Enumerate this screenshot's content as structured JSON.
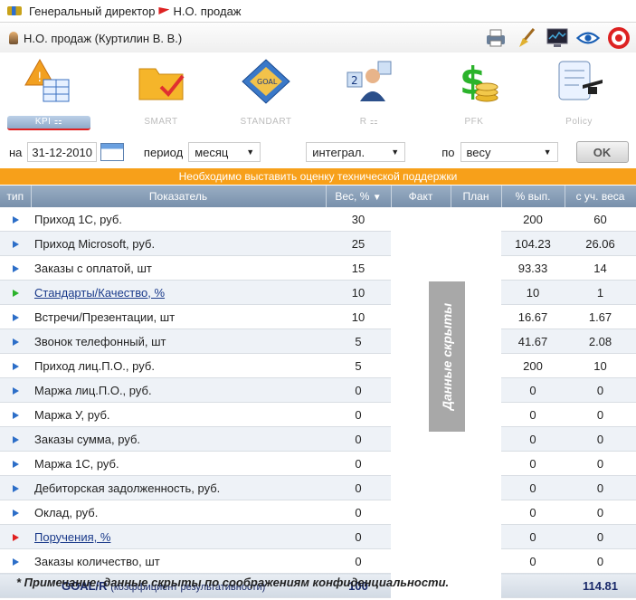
{
  "titlebar": {
    "role": "Генеральный директор",
    "dept": "Н.О. продаж"
  },
  "user": {
    "name": "Н.О. продаж  (Куртилин В. В.)"
  },
  "tools": [
    "printer-icon",
    "broom-icon",
    "monitor-icon",
    "eye-icon",
    "target-icon"
  ],
  "nav": [
    {
      "label": "KPI",
      "icon": "warning-table-icon",
      "active": true
    },
    {
      "label": "SMART",
      "icon": "folder-check-icon",
      "active": false
    },
    {
      "label": "STANDART",
      "icon": "goal-compass-icon",
      "active": false
    },
    {
      "label": "R",
      "icon": "person-numbers-icon",
      "active": false
    },
    {
      "label": "PFK",
      "icon": "dollar-coins-icon",
      "active": false
    },
    {
      "label": "Policy",
      "icon": "scroll-graduation-icon",
      "active": false
    }
  ],
  "filters": {
    "date_label": "на",
    "date_value": "31-12-2010",
    "period_label": "период",
    "period_value": "месяц",
    "mode_value": "интеграл.",
    "by_label": "по",
    "by_value": "весу",
    "ok_label": "OK"
  },
  "notice": "Необходимо выставить оценку технической поддержки",
  "table": {
    "headers": [
      "тип",
      "Показатель",
      "Вес, %",
      "Факт",
      "План",
      "% вып.",
      "с уч. веса"
    ],
    "rows": [
      {
        "type": "blue",
        "name": "Приход 1С, руб.",
        "link": false,
        "weight": "30",
        "pct": "200",
        "weighted": "60"
      },
      {
        "type": "blue",
        "name": "Приход Microsoft, руб.",
        "link": false,
        "weight": "25",
        "pct": "104.23",
        "weighted": "26.06"
      },
      {
        "type": "blue",
        "name": "Заказы с оплатой, шт",
        "link": false,
        "weight": "15",
        "pct": "93.33",
        "weighted": "14"
      },
      {
        "type": "green",
        "name": "Стандарты/Качество, %",
        "link": true,
        "weight": "10",
        "pct": "10",
        "weighted": "1"
      },
      {
        "type": "blue",
        "name": "Встречи/Презентации, шт",
        "link": false,
        "weight": "10",
        "pct": "16.67",
        "weighted": "1.67"
      },
      {
        "type": "blue",
        "name": "Звонок телефонный, шт",
        "link": false,
        "weight": "5",
        "pct": "41.67",
        "weighted": "2.08"
      },
      {
        "type": "blue",
        "name": "Приход лиц.П.О., руб.",
        "link": false,
        "weight": "5",
        "pct": "200",
        "weighted": "10"
      },
      {
        "type": "blue",
        "name": "Маржа лиц.П.О., руб.",
        "link": false,
        "weight": "0",
        "pct": "0",
        "weighted": "0"
      },
      {
        "type": "blue",
        "name": "Маржа У, руб.",
        "link": false,
        "weight": "0",
        "pct": "0",
        "weighted": "0"
      },
      {
        "type": "blue",
        "name": "Заказы сумма, руб.",
        "link": false,
        "weight": "0",
        "pct": "0",
        "weighted": "0"
      },
      {
        "type": "blue",
        "name": "Маржа 1С, руб.",
        "link": false,
        "weight": "0",
        "pct": "0",
        "weighted": "0"
      },
      {
        "type": "blue",
        "name": "Дебиторская задолженность, руб.",
        "link": false,
        "weight": "0",
        "pct": "0",
        "weighted": "0"
      },
      {
        "type": "blue",
        "name": "Оклад, руб.",
        "link": false,
        "weight": "0",
        "pct": "0",
        "weighted": "0"
      },
      {
        "type": "red",
        "name": "Поручения, %",
        "link": true,
        "weight": "0",
        "pct": "0",
        "weighted": "0"
      },
      {
        "type": "blue",
        "name": "Заказы количество, шт",
        "link": false,
        "weight": "0",
        "pct": "0",
        "weighted": "0"
      }
    ],
    "total": {
      "label": "GOAL/R",
      "sub": "(коэффициент результативности)",
      "weight": "100",
      "weighted": "114.81"
    }
  },
  "hidden_label": "Данные скрыты",
  "footnote": "* Примечание: данные скрыты по соображениям конфиденциальности."
}
